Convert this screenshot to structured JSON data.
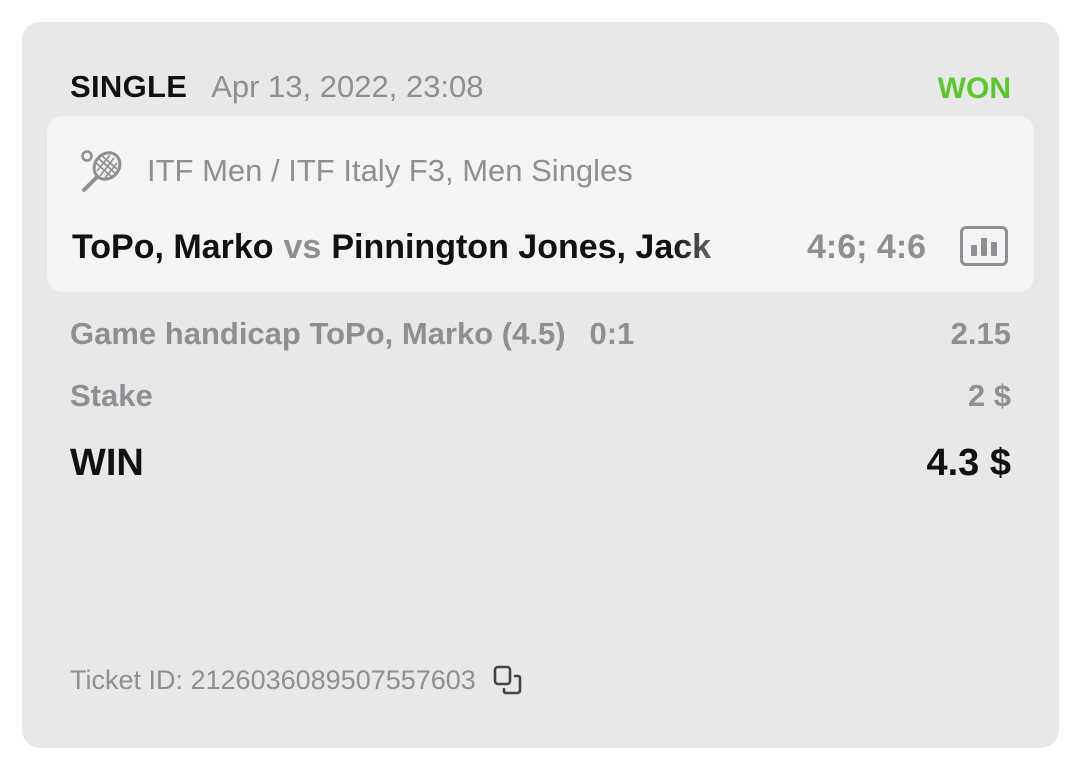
{
  "bet": {
    "type": "SINGLE",
    "date": "Apr 13, 2022, 23:08",
    "status": "WON",
    "status_color": "#5ac72a"
  },
  "event": {
    "sport_icon": "tennis-racket-icon",
    "league": "ITF Men / ITF Italy F3, Men Singles",
    "team_home": "ToPo, Marko",
    "vs_label": "vs",
    "team_away": "Pinnington Jones, Jack",
    "score": "4:6; 4:6",
    "stats_icon": "stats-icon"
  },
  "selection": {
    "market": "Game handicap ToPo, Marko (4.5)",
    "score_at_bet": "0:1",
    "odds": "2.15"
  },
  "stake": {
    "label": "Stake",
    "value": "2 $"
  },
  "win": {
    "label": "WIN",
    "value": "4.3 $"
  },
  "ticket": {
    "label": "Ticket ID: 2126036089507557603",
    "copy_icon": "copy-icon"
  }
}
